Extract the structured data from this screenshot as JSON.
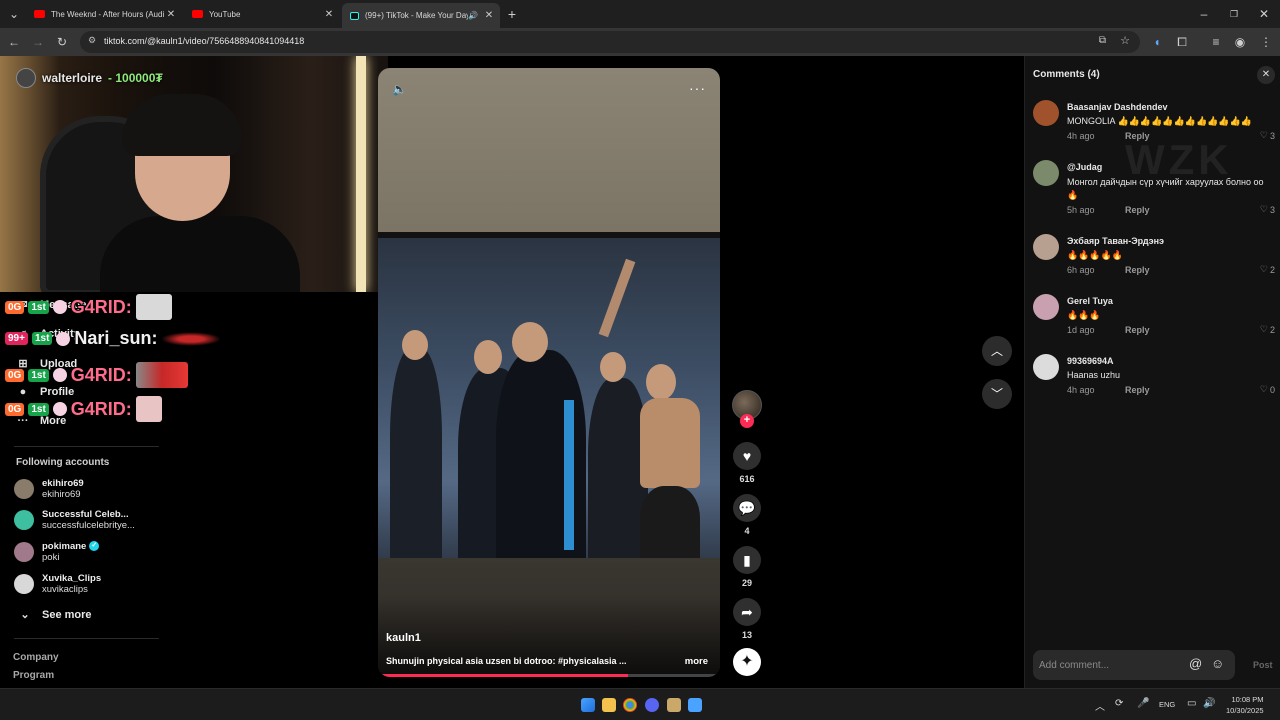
{
  "browser": {
    "tabs": [
      {
        "title": "The Weeknd - After Hours (Audio)",
        "favicon": "youtube-icon",
        "active": false
      },
      {
        "title": "YouTube",
        "favicon": "youtube-icon",
        "active": false
      },
      {
        "title": "(99+) TikTok - Make Your Day",
        "favicon": "tiktok-icon",
        "active": true
      }
    ],
    "url": "tiktok.com/@kauln1/video/7566488940841094418"
  },
  "stream_overlay": {
    "streamer_name": "walterloire",
    "streamer_coins": "- 100000₮",
    "chat": [
      {
        "user": "G4RID:",
        "badge": "0G",
        "level": "1st"
      },
      {
        "user": "Nari_sun:",
        "badge": "99+",
        "level": "1st"
      },
      {
        "user": "G4RID:",
        "badge": "0G",
        "level": "1st"
      },
      {
        "user": "G4RID:",
        "badge": "0G",
        "level": "1st"
      }
    ]
  },
  "sidebar": {
    "nav": [
      {
        "label": "Messages",
        "icon": "message-icon"
      },
      {
        "label": "Activity",
        "icon": "bell-icon"
      },
      {
        "label": "Upload",
        "icon": "plus-square-icon"
      },
      {
        "label": "Profile",
        "icon": "user-icon"
      },
      {
        "label": "More",
        "icon": "ellipsis-icon"
      }
    ],
    "following_title": "Following accounts",
    "accounts": [
      {
        "name": "ekihiro69",
        "handle": "ekihiro69",
        "verified": false
      },
      {
        "name": "Successful Celeb...",
        "handle": "successfulcelebritye...",
        "verified": false
      },
      {
        "name": "pokimane",
        "handle": "poki",
        "verified": true
      },
      {
        "name": "Xuvika_Clips",
        "handle": "xuvikaclips",
        "verified": false
      }
    ],
    "see_more": "See more",
    "footer": [
      "Company",
      "Program"
    ]
  },
  "video": {
    "author": "kauln1",
    "caption": "Shunujin physical asia uzsen bi dotroo: #physicalasia ...",
    "more_label": "more",
    "progress": 0.73,
    "likes": "616",
    "comments": "4",
    "saves": "29",
    "shares": "13"
  },
  "comments_panel": {
    "title": "Comments (4)",
    "watermark": "WZK",
    "items": [
      {
        "user": "Baasanjav Dashdendev",
        "text": "MONGOLIA 👍👍👍👍👍👍👍👍👍👍👍👍",
        "time": "4h ago",
        "reply": "Reply",
        "likes": "3"
      },
      {
        "user": "@Judag",
        "text": "Монгол дайчдын сүр хүчийг харуулах болно оо 🔥",
        "time": "5h ago",
        "reply": "Reply",
        "likes": "3"
      },
      {
        "user": "Эхбаяр Таван-Эрдэнэ",
        "text": "🔥🔥🔥🔥🔥",
        "time": "6h ago",
        "reply": "Reply",
        "likes": "2"
      },
      {
        "user": "Gerel Tuya",
        "text": "🔥🔥🔥",
        "time": "1d ago",
        "reply": "Reply",
        "likes": "2"
      },
      {
        "user": "99369694A",
        "text": "Haanas uzhu",
        "time": "4h ago",
        "reply": "Reply",
        "likes": "0"
      }
    ],
    "input_placeholder": "Add comment...",
    "post_label": "Post"
  },
  "taskbar": {
    "language": "ENG",
    "time": "10:08 PM",
    "date": "10/30/2025"
  },
  "colors": {
    "accent": "#fe2c55",
    "panel_bg": "#121212",
    "verified": "#20d5ec"
  }
}
